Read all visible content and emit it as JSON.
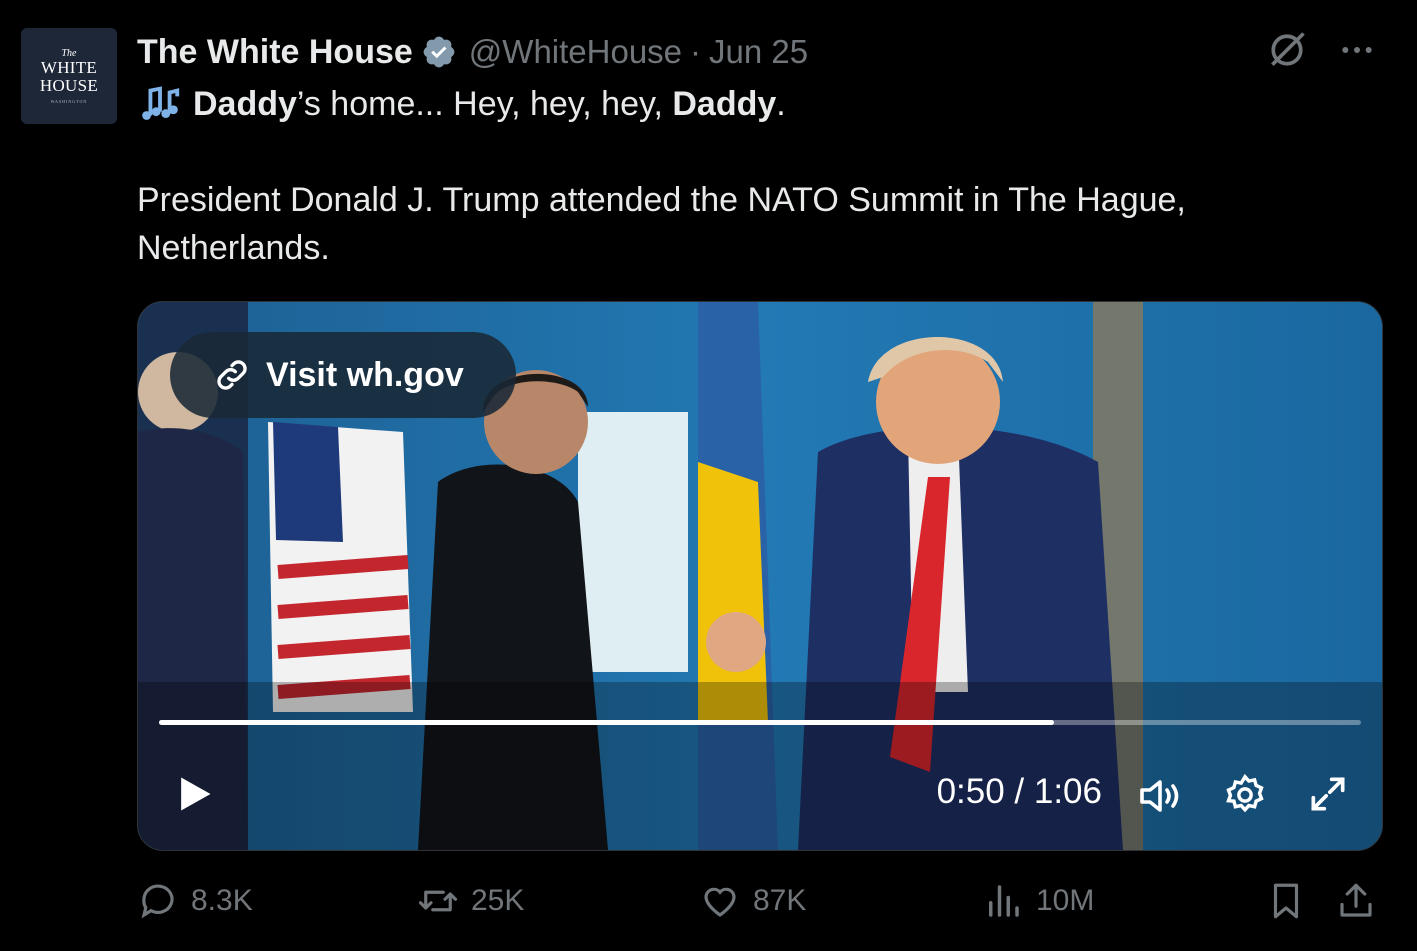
{
  "author": {
    "avatar_the": "The",
    "avatar_line1": "WHITE",
    "avatar_line2": "HOUSE",
    "avatar_small": "WASHINGTON",
    "name": "The White House",
    "handle": "@WhiteHouse",
    "separator": "·",
    "date": "Jun 25"
  },
  "tweet": {
    "line1_bold1": "Daddy",
    "line1_mid": "’s home... Hey, hey, hey, ",
    "line1_bold2": "Daddy",
    "line1_end": ".",
    "body": "President Donald J. Trump attended the NATO Summit in The Hague, Netherlands."
  },
  "video": {
    "link_label": "Visit wh.gov",
    "time": "0:50 / 1:06",
    "progress": 0.745
  },
  "actions": {
    "replies": "8.3K",
    "retweets": "25K",
    "likes": "87K",
    "views": "10M"
  },
  "colors": {
    "background": "#000000",
    "muted": "#71767b",
    "text": "#e7e9ea",
    "verified": "#829aab"
  }
}
